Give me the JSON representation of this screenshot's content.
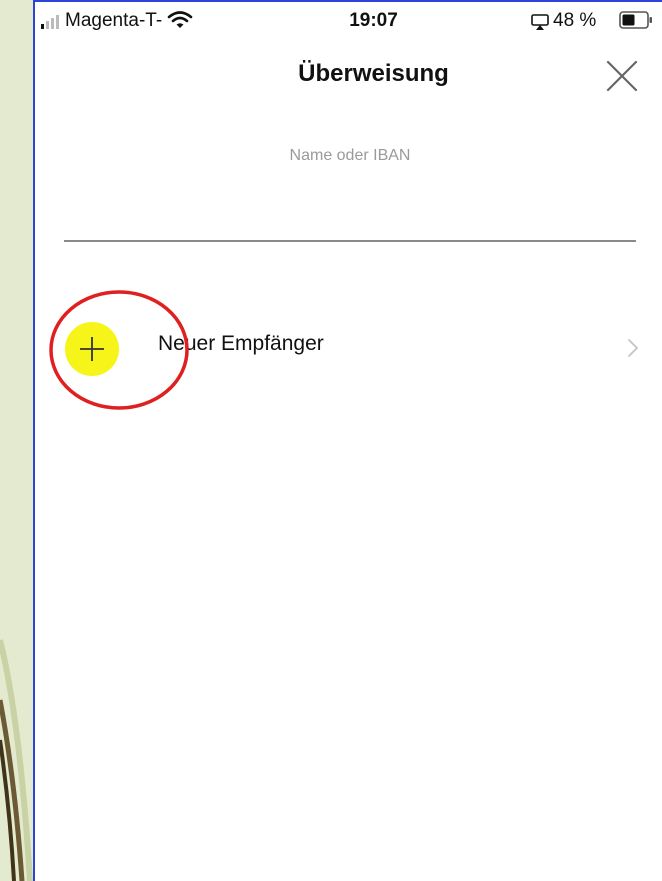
{
  "status_bar": {
    "carrier": "Magenta-T-",
    "time": "19:07",
    "battery_percent": "48 %",
    "icons": [
      "signal-icon",
      "wifi-icon",
      "airplay-icon",
      "battery-icon"
    ]
  },
  "header": {
    "title": "Überweisung",
    "close_icon": "close-icon"
  },
  "search": {
    "placeholder": "Name oder IBAN",
    "value": ""
  },
  "new_recipient": {
    "label": "Neuer Empfänger",
    "icon": "plus-icon",
    "icon_color": "#f7f41a",
    "chevron_icon": "chevron-right-icon"
  },
  "annotation": {
    "highlight_color": "#e02020"
  }
}
